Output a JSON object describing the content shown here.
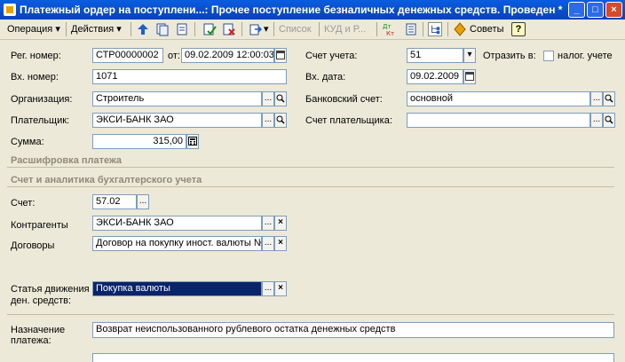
{
  "window": {
    "title": "Платежный ордер на поступлени...: Прочее поступление безналичных денежных средств. Проведен *",
    "minimize_symbol": "_",
    "maximize_symbol": "□",
    "close_symbol": "×"
  },
  "toolbar": {
    "operation_label": "Операция",
    "actions_label": "Действия",
    "list_label": "Список",
    "kud_label": "КУД и Р...",
    "advice_label": "Советы",
    "help_label": "?",
    "dropdown_symbol": "▾"
  },
  "form": {
    "reg_number": {
      "label": "Рег. номер:",
      "value": "СТР00000002"
    },
    "date_from": {
      "label": "от:",
      "value": "09.02.2009 12:00:03"
    },
    "account": {
      "label": "Счет учета:",
      "value": "51"
    },
    "reflect_in": {
      "label": "Отразить в:",
      "checkbox_label": "налог. учете",
      "checked": false
    },
    "in_number": {
      "label": "Вх. номер:",
      "value": "1071"
    },
    "in_date": {
      "label": "Вх. дата:",
      "value": "09.02.2009"
    },
    "organization": {
      "label": "Организация:",
      "value": "Строитель"
    },
    "bank_account": {
      "label": "Банковский счет:",
      "value": "основной"
    },
    "payer": {
      "label": "Плательщик:",
      "value": "ЭКСИ-БАНК ЗАО"
    },
    "payer_account": {
      "label": "Счет плательщика:",
      "value": ""
    },
    "sum": {
      "label": "Сумма:",
      "value": "315,00"
    }
  },
  "payment_details": {
    "section_title": "Расшифровка платежа",
    "subsection_title": "Счет и аналитика бухгалтерского учета",
    "account": {
      "label": "Счет:",
      "value": "57.02"
    },
    "counterparties": {
      "label": "Контрагенты",
      "value": "ЭКСИ-БАНК ЗАО"
    },
    "contracts": {
      "label": "Договоры",
      "value": "Договор на покупку иност. валюты №"
    },
    "cash_flow_item": {
      "label_line1": "Статья движения",
      "label_line2": "ден. средств:",
      "value": "Покупка валюты"
    }
  },
  "purpose": {
    "label_line1": "Назначение",
    "label_line2": "платежа:",
    "value": "Возврат неиспользованного рублевого остатка денежных средств"
  },
  "button_symbols": {
    "select": "...",
    "clear": "×",
    "dropdown": "▾"
  }
}
